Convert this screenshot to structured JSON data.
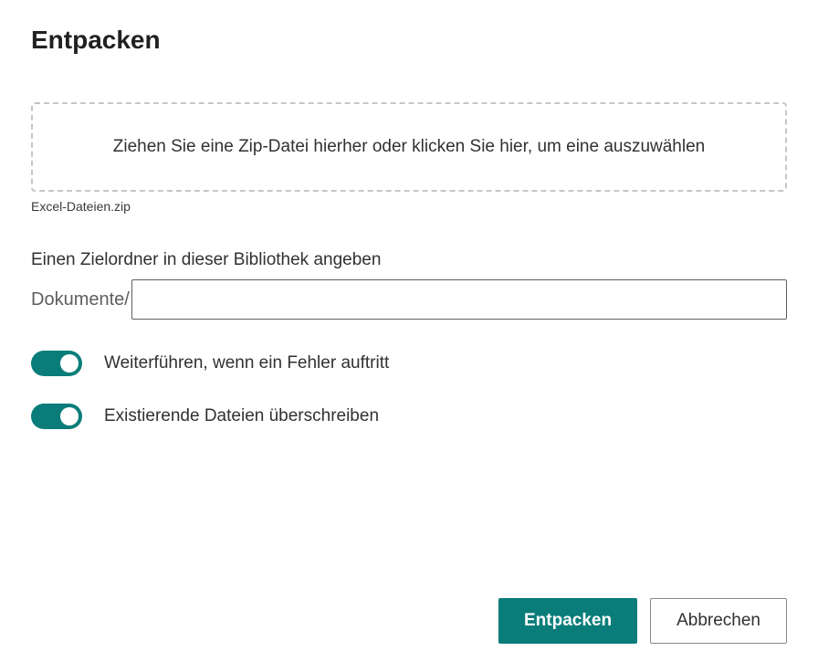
{
  "title": "Entpacken",
  "dropzone": {
    "text": "Ziehen Sie eine Zip-Datei hierher oder klicken Sie hier, um eine auszuwählen"
  },
  "selected_file": "Excel-Dateien.zip",
  "destination": {
    "label": "Einen Zielordner in dieser Bibliothek angeben",
    "prefix": "Dokumente/",
    "value": ""
  },
  "toggles": {
    "continue_on_error": {
      "label": "Weiterführen, wenn ein Fehler auftritt",
      "on": true
    },
    "overwrite_existing": {
      "label": "Existierende Dateien überschreiben",
      "on": true
    }
  },
  "buttons": {
    "primary": "Entpacken",
    "secondary": "Abbrechen"
  }
}
